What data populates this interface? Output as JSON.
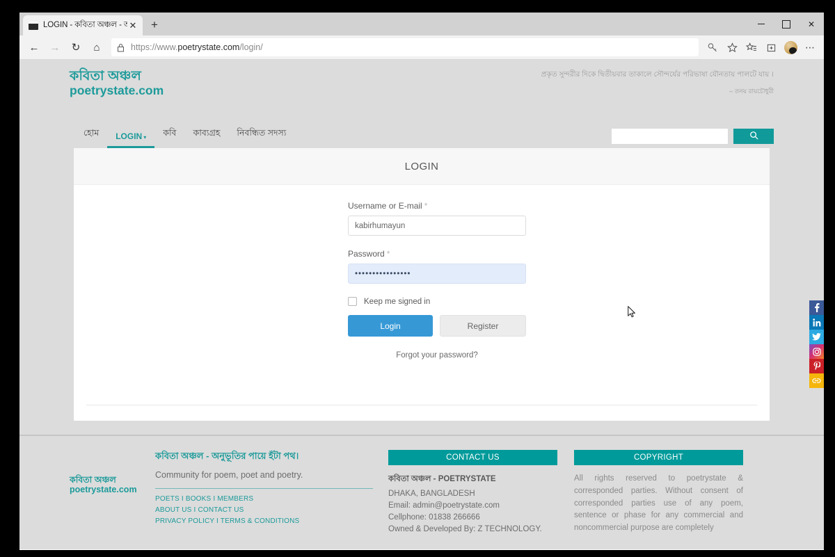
{
  "browser": {
    "tab": {
      "title": "LOGIN - কবিতা অঞ্চল - অনুভূতি",
      "favicon": "page-icon",
      "close_label": "✕"
    },
    "new_tab_label": "+",
    "window_controls": {
      "minimize": "–",
      "maximize": "□",
      "close": "✕"
    },
    "nav": {
      "back": "←",
      "forward": "→",
      "refresh": "↻",
      "home": "⌂"
    },
    "url": {
      "scheme": "https://www.",
      "domain": "poetrystate.com",
      "path": "/login/"
    },
    "toolbar_icons": [
      "key-icon",
      "star-icon",
      "favorites-list-icon",
      "collections-icon",
      "profile-avatar",
      "more-menu-icon"
    ]
  },
  "site": {
    "logo": {
      "bn": "কবিতা অঞ্চল",
      "en": "poetrystate.com"
    },
    "quote": {
      "text": "প্রকৃত সুন্দরীর দিকে দ্বিতীয়বার তাকালে সৌন্দর্যের পরিভাষা যৌনতায় পালটে যায় ।",
      "author": "– তনয় রায়চৌধুরী"
    },
    "nav_items": [
      {
        "label": "হোম",
        "active": false,
        "has_caret": false
      },
      {
        "label": "LOGIN",
        "active": true,
        "has_caret": true
      },
      {
        "label": "কবি",
        "active": false,
        "has_caret": false
      },
      {
        "label": "কাব্যগ্রহ",
        "active": false,
        "has_caret": false
      },
      {
        "label": "নিবন্ধিত সদস্য",
        "active": false,
        "has_caret": false
      }
    ],
    "nav_caret": "▾",
    "search": {
      "value": "",
      "placeholder": "",
      "button_icon": "search-icon"
    }
  },
  "page": {
    "title": "LOGIN",
    "form": {
      "username": {
        "label": "Username or E-mail",
        "required_mark": "*",
        "value": "kabirhumayun",
        "placeholder": ""
      },
      "password": {
        "label": "Password",
        "required_mark": "*",
        "value": "••••••••••••••••",
        "placeholder": ""
      },
      "keep_signed_in": {
        "label": "Keep me signed in",
        "checked": false
      },
      "login_button": "Login",
      "register_button": "Register",
      "forgot_link": "Forgot your password?"
    }
  },
  "footer": {
    "logo": {
      "bn": "কবিতা অঞ্চল",
      "en": "poetrystate.com"
    },
    "tagline_bn": "কবিতা অঞ্চল - অনুভূতির পায়ে হঁটা পথ।",
    "tagline_en": "Community for poem, poet and poetry.",
    "link_rows": [
      "POETS I BOOKS I MEMBERS",
      "ABOUT US I CONTACT US",
      "PRIVACY POLICY I TERMS & CONDITIONS"
    ],
    "contact": {
      "heading": "CONTACT US",
      "lines": [
        "কবিতা অঞ্চল - POETRYSTATE",
        "DHAKA, BANGLADESH",
        "Email: admin@poetrystate.com",
        "Cellphone: 01838 266666",
        "Owned & Developed By: Z TECHNOLOGY."
      ]
    },
    "copyright": {
      "heading": "COPYRIGHT",
      "text": "All rights reserved to poetrystate & corresponded parties. Without consent of corresponded parties use of any poem, sentence or phase for any commercial and noncommercial purpose are completely"
    }
  },
  "social": [
    {
      "name": "facebook",
      "glyph": "f"
    },
    {
      "name": "linkedin",
      "glyph": "in"
    },
    {
      "name": "twitter",
      "glyph": "🐦"
    },
    {
      "name": "instagram",
      "glyph": "◎"
    },
    {
      "name": "pinterest",
      "glyph": "P"
    },
    {
      "name": "link",
      "glyph": "∞"
    }
  ],
  "colors": {
    "teal": "#1d9a9a",
    "teal_solid": "#009a9a",
    "login_blue": "#3699d6",
    "page_grey": "#dcdcdc",
    "autofill_blue": "#e3ecfb"
  }
}
